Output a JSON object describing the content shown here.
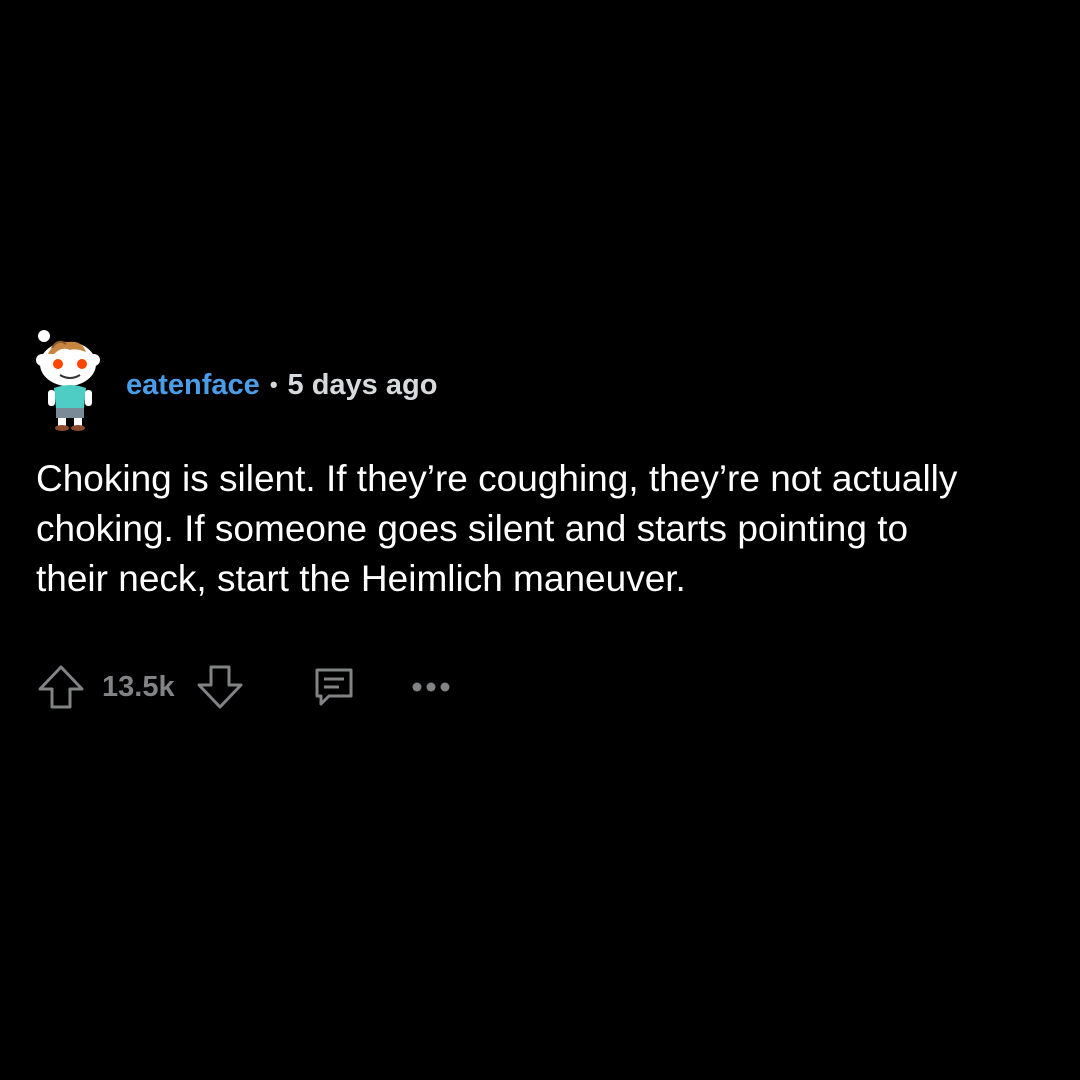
{
  "comment": {
    "username": "eatenface",
    "separator": "•",
    "time": "5 days ago",
    "body": "Choking is silent. If they’re coughing, they’re not actually choking. If someone goes silent and starts pointing to their neck, start the Heimlich maneuver.",
    "vote_count": "13.5k"
  },
  "icons": {
    "upvote": "upvote-arrow-icon",
    "downvote": "downvote-arrow-icon",
    "reply": "comment-bubble-icon",
    "more": "more-options-icon"
  },
  "colors": {
    "background": "#000000",
    "username": "#4a9ee8",
    "meta_text": "#d7dadc",
    "body_text": "#ffffff",
    "action_gray": "#818384"
  }
}
